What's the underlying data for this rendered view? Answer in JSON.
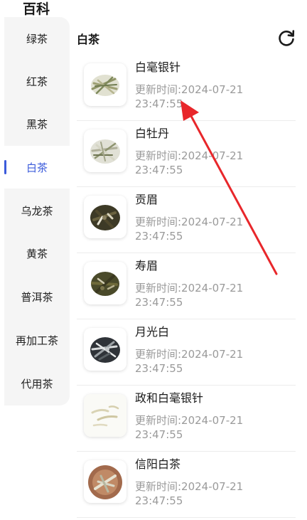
{
  "header": {
    "title": "百科"
  },
  "sidebar": {
    "categories": [
      {
        "label": "绿茶"
      },
      {
        "label": "红茶"
      },
      {
        "label": "黑茶"
      },
      {
        "label": "白茶"
      },
      {
        "label": "乌龙茶"
      },
      {
        "label": "黄茶"
      },
      {
        "label": "普洱茶"
      },
      {
        "label": "再加工茶"
      },
      {
        "label": "代用茶"
      }
    ],
    "selected": "白茶"
  },
  "main": {
    "section_title": "白茶",
    "refresh_icon": "refresh-icon",
    "items": [
      {
        "name": "白毫银针",
        "time": "更新时间:2024-07-21 23:47:55"
      },
      {
        "name": "白牡丹",
        "time": "更新时间:2024-07-21 23:47:55"
      },
      {
        "name": "贡眉",
        "time": "更新时间:2024-07-21 23:47:55"
      },
      {
        "name": "寿眉",
        "time": "更新时间:2024-07-21 23:47:55"
      },
      {
        "name": "月光白",
        "time": "更新时间:2024-07-21 23:47:55"
      },
      {
        "name": "政和白毫银针",
        "time": "更新时间:2024-07-21 23:47:55"
      },
      {
        "name": "信阳白茶",
        "time": "更新时间:2024-07-21 23:47:55"
      }
    ]
  },
  "colors": {
    "accent": "#3b5bdb",
    "annotation_arrow": "#e8272b",
    "sidebar_bg": "#f5f5f5",
    "secondary_text": "#9a9a9a"
  }
}
